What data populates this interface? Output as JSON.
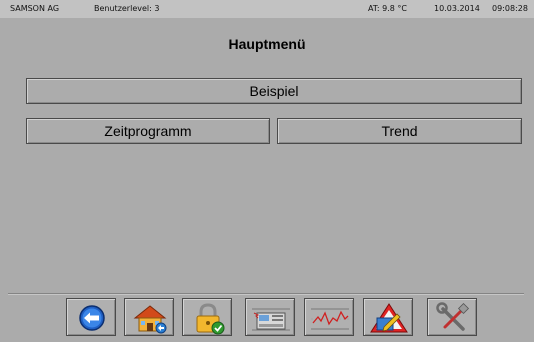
{
  "status": {
    "company": "SAMSON AG",
    "user_level": "Benutzerlevel: 3",
    "outdoor_temp": "AT:  9.8 °C",
    "date": "10.03.2014",
    "time": "09:08:28"
  },
  "title": "Hauptmenü",
  "menu": {
    "beispiel": "Beispiel",
    "zeitprogramm": "Zeitprogramm",
    "trend": "Trend"
  },
  "toolbar": {
    "icons": [
      "back-arrow-icon",
      "home-icon",
      "lock-icon",
      "device-panel-icon",
      "trend-chart-icon",
      "alarm-warning-icon",
      "tools-icon"
    ]
  },
  "colors": {
    "background": "#ababab",
    "status_bar": "#c2c2c2",
    "back_button_blue": "#1f5fc4",
    "warning_red": "#d62020"
  }
}
